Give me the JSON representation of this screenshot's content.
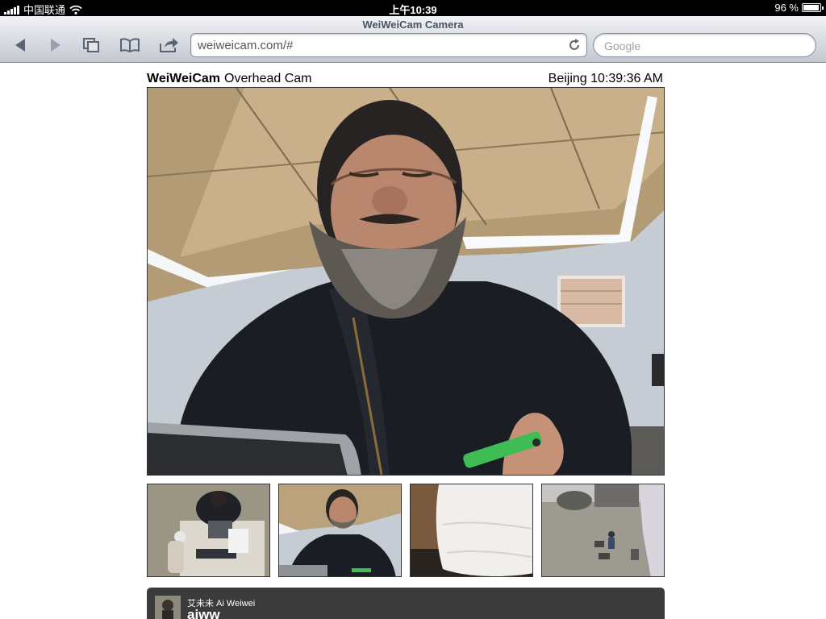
{
  "status_bar": {
    "carrier": "中国联通",
    "time": "上午10:39",
    "battery": "96 %",
    "battery_level": 0.96
  },
  "browser": {
    "page_title": "WeiWeiCam Camera",
    "url": "weiweicam.com/#",
    "search_placeholder": "Google",
    "icons": [
      "back-icon",
      "forward-icon",
      "pages-icon",
      "bookmarks-icon",
      "share-icon",
      "reload-icon"
    ]
  },
  "page": {
    "brand": "WeiWeiCam",
    "camera_name": "Overhead Cam",
    "clock": "Beijing 10:39:36 AM"
  },
  "thumbnails": [
    {
      "name": "thumb-camera-1"
    },
    {
      "name": "thumb-camera-2"
    },
    {
      "name": "thumb-camera-3"
    },
    {
      "name": "thumb-camera-4"
    }
  ],
  "profile": {
    "display_name": "艾未未 Ai Weiwei",
    "handle": "aiww"
  },
  "colors": {
    "status_bar_bg": "#000000",
    "profile_bg": "#3b3b3b",
    "toolbar_icon": "#5b6270"
  }
}
